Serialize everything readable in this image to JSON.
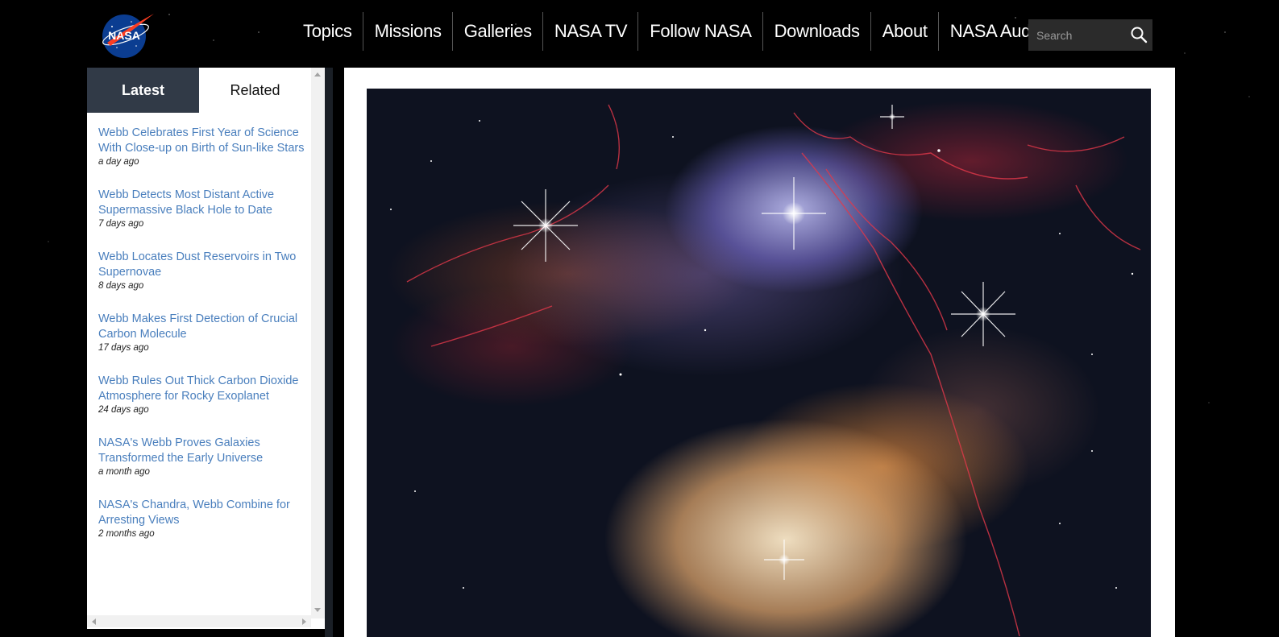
{
  "header": {
    "logo_alt": "NASA",
    "nav": [
      "Topics",
      "Missions",
      "Galleries",
      "NASA TV",
      "Follow NASA",
      "Downloads",
      "About",
      "NASA Audiences"
    ],
    "search": {
      "placeholder": "Search"
    }
  },
  "sidebar": {
    "tabs": [
      {
        "label": "Latest",
        "active": true
      },
      {
        "label": "Related",
        "active": false
      }
    ],
    "items": [
      {
        "title": "Webb Celebrates First Year of Science With Close-up on Birth of Sun-like Stars",
        "time": "a day ago"
      },
      {
        "title": "Webb Detects Most Distant Active Supermassive Black Hole to Date",
        "time": "7 days ago"
      },
      {
        "title": "Webb Locates Dust Reservoirs in Two Supernovae",
        "time": "8 days ago"
      },
      {
        "title": "Webb Makes First Detection of Crucial Carbon Molecule",
        "time": "17 days ago"
      },
      {
        "title": "Webb Rules Out Thick Carbon Dioxide Atmosphere for Rocky Exoplanet",
        "time": "24 days ago"
      },
      {
        "title": "NASA's Webb Proves Galaxies Transformed the Early Universe",
        "time": "a month ago"
      },
      {
        "title": "NASA's Chandra, Webb Combine for Arresting Views",
        "time": "2 months ago"
      }
    ]
  },
  "colors": {
    "link": "#4a7fbd",
    "tab_active_bg": "#313a47",
    "page_bg": "#000000"
  },
  "main": {
    "image_icon": "nebula-image"
  }
}
